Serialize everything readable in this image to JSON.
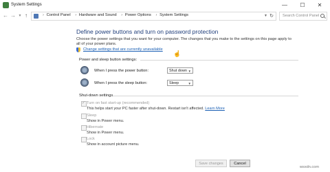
{
  "window": {
    "title": "System Settings"
  },
  "address": {
    "breadcrumbs": [
      "Control Panel",
      "Hardware and Sound",
      "Power Options",
      "System Settings"
    ],
    "search_placeholder": "Search Control Panel"
  },
  "main": {
    "heading": "Define power buttons and turn on password protection",
    "intro": "Choose the power settings that you want for your computer. The changes that you make to the settings on this page apply to all of your power plans.",
    "change_link": "Change settings that are currently unavailable",
    "power_sleep": {
      "section_title": "Power and sleep button settings:",
      "power_label": "When I press the power button:",
      "power_value": "Shut down",
      "sleep_label": "When I press the sleep button:",
      "sleep_value": "Sleep"
    },
    "shutdown": {
      "section_title": "Shut-down settings",
      "items": [
        {
          "label": "Turn on fast start-up (recommended)",
          "desc": "This helps start your PC faster after shut-down. Restart isn't affected.",
          "link": "Learn More",
          "checked": true
        },
        {
          "label": "Sleep",
          "desc": "Show in Power menu.",
          "checked": false
        },
        {
          "label": "Hibernate",
          "desc": "Show in Power menu.",
          "checked": false
        },
        {
          "label": "Lock",
          "desc": "Show in account picture menu.",
          "checked": false
        }
      ]
    }
  },
  "footer": {
    "save_label": "Save changes",
    "cancel_label": "Cancel"
  },
  "watermark": "wsxdn.com"
}
